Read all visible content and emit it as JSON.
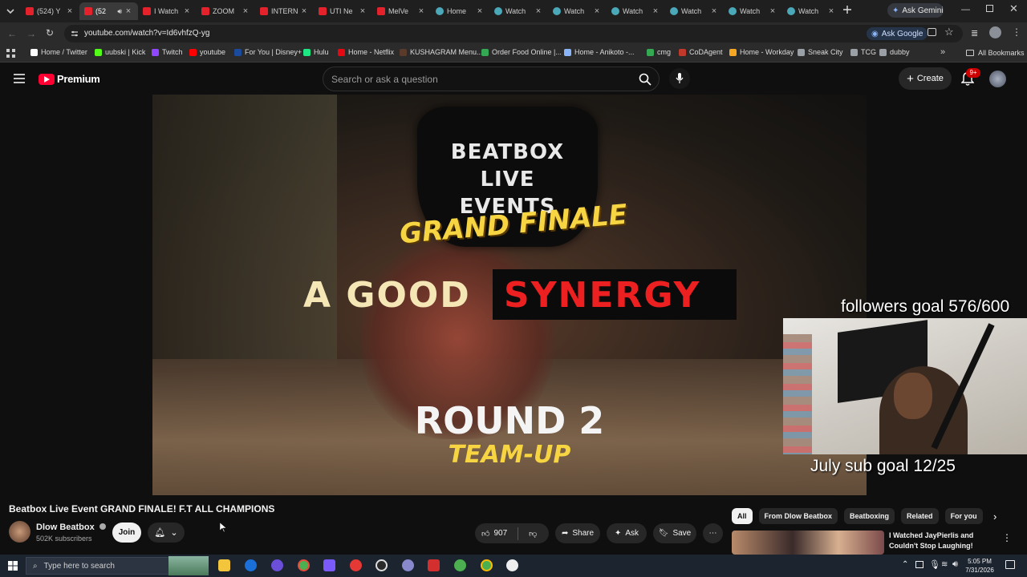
{
  "browser": {
    "tabs": [
      {
        "label": "(524) Y",
        "icon": "youtube-icon",
        "active": false
      },
      {
        "label": "(52",
        "icon": "youtube-icon",
        "active": true
      },
      {
        "label": "I Watch",
        "icon": "youtube-icon",
        "active": false
      },
      {
        "label": "ZOOM",
        "icon": "youtube-icon",
        "active": false
      },
      {
        "label": "INTERN",
        "icon": "youtube-icon",
        "active": false
      },
      {
        "label": "UTI Ne",
        "icon": "youtube-icon",
        "active": false
      },
      {
        "label": "MelVe",
        "icon": "youtube-icon",
        "active": false
      },
      {
        "label": "Home",
        "icon": "globe-icon",
        "active": false
      },
      {
        "label": "Watch",
        "icon": "globe-icon",
        "active": false
      },
      {
        "label": "Watch",
        "icon": "globe-icon",
        "active": false
      },
      {
        "label": "Watch",
        "icon": "globe-icon",
        "active": false
      },
      {
        "label": "Watch",
        "icon": "globe-icon",
        "active": false
      },
      {
        "label": "Watch",
        "icon": "globe-icon",
        "active": false
      },
      {
        "label": "Watch",
        "icon": "globe-icon",
        "active": false
      }
    ],
    "ask_gemini": "Ask Gemini",
    "url": "youtube.com/watch?v=Id6vhfzQ-yg",
    "ask_google": "Ask Google",
    "bookmarks": [
      {
        "label": "Home / Twitter",
        "color": "#ffffff"
      },
      {
        "label": "uubski | Kick",
        "color": "#53fc18"
      },
      {
        "label": "Twitch",
        "color": "#9146ff"
      },
      {
        "label": "youtube",
        "color": "#ff0000"
      },
      {
        "label": "For You | Disney+",
        "color": "#1a4b9c"
      },
      {
        "label": "Hulu",
        "color": "#1ce783"
      },
      {
        "label": "Home - Netflix",
        "color": "#e50914"
      },
      {
        "label": "KUSHAGRAM Menu...",
        "color": "#5a3a2a"
      },
      {
        "label": "Order Food Online |...",
        "color": "#34a853"
      },
      {
        "label": "Home - Anikoto -...",
        "color": "#8ab4f8"
      },
      {
        "label": "cmg",
        "color": "#34a853"
      },
      {
        "label": "CoDAgent",
        "color": "#c0392b"
      },
      {
        "label": "Home - Workday",
        "color": "#f5a623"
      },
      {
        "label": "Sneak City",
        "color": "#9aa0a6"
      },
      {
        "label": "TCG",
        "color": "#9aa0a6"
      },
      {
        "label": "dubby",
        "color": "#9aa0a6"
      }
    ],
    "all_bookmarks": "All Bookmarks"
  },
  "youtube": {
    "logo_text": "Premium",
    "search_placeholder": "Search or ask a question",
    "create_label": "Create",
    "notification_count": "9+"
  },
  "video": {
    "thumb_line1": "BEATBOX",
    "thumb_line2": "LIVE",
    "thumb_line3": "EVENTS",
    "grand_finale": "GRAND FINALE",
    "a_good": "A GOOD",
    "synergy": "SYNERGY",
    "round": "ROUND 2",
    "team_up": "TEAM-UP"
  },
  "overlay": {
    "followers_goal": "followers goal 576/600",
    "sub_goal": "July sub goal 12/25"
  },
  "watch": {
    "title": "Beatbox Live Event GRAND FINALE! F.T ALL CHAMPIONS",
    "channel": "Dlow Beatbox",
    "subscribers": "502K subscribers",
    "join": "Join",
    "likes": "907",
    "share": "Share",
    "ask": "Ask",
    "save": "Save"
  },
  "recommendations": {
    "chips": [
      "All",
      "From Dlow Beatbox",
      "Beatboxing",
      "Related",
      "For you"
    ],
    "first_title": "I Watched JayPierlis and Couldn't Stop Laughing!"
  },
  "taskbar": {
    "search_placeholder": "Type here to search",
    "time": "5:05 PM",
    "date": "7/31/2026"
  }
}
